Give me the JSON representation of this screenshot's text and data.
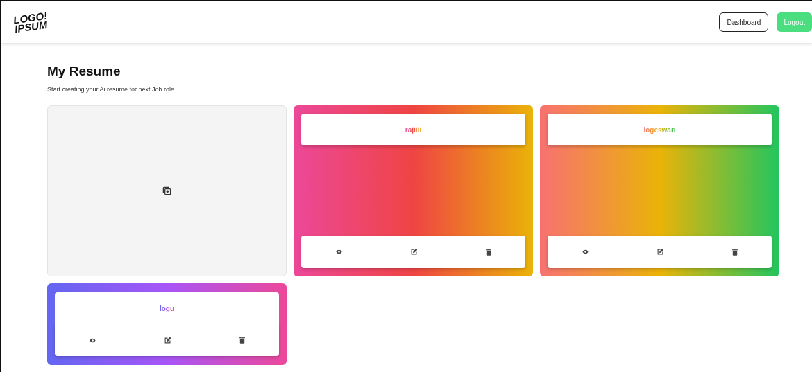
{
  "header": {
    "logo": {
      "line_1": "LOGO!",
      "line_2": "IPSUM"
    },
    "buttons": [
      {
        "label": "Dashboard",
        "kind": "outline"
      },
      {
        "label": "Logout",
        "kind": "primary"
      }
    ]
  },
  "page": {
    "title": "My Resume",
    "subtitle": "Start creating your Ai resume for next Job role"
  },
  "resumes": [
    {
      "title": "rajiiii",
      "kind": "full",
      "gradient": [
        {
          "color": "#ec4899"
        },
        {
          "color": "#ef4444"
        },
        {
          "color": "#eab308"
        }
      ]
    },
    {
      "title": "logeswari",
      "kind": "full",
      "gradient": [
        {
          "color": "#f87171"
        },
        {
          "color": "#eab308"
        },
        {
          "color": "#22c55e"
        }
      ]
    },
    {
      "title": "logu",
      "kind": "compact",
      "gradient": [
        {
          "color": "#6366f1"
        },
        {
          "color": "#a855f7"
        },
        {
          "color": "#ec4899"
        }
      ]
    }
  ]
}
